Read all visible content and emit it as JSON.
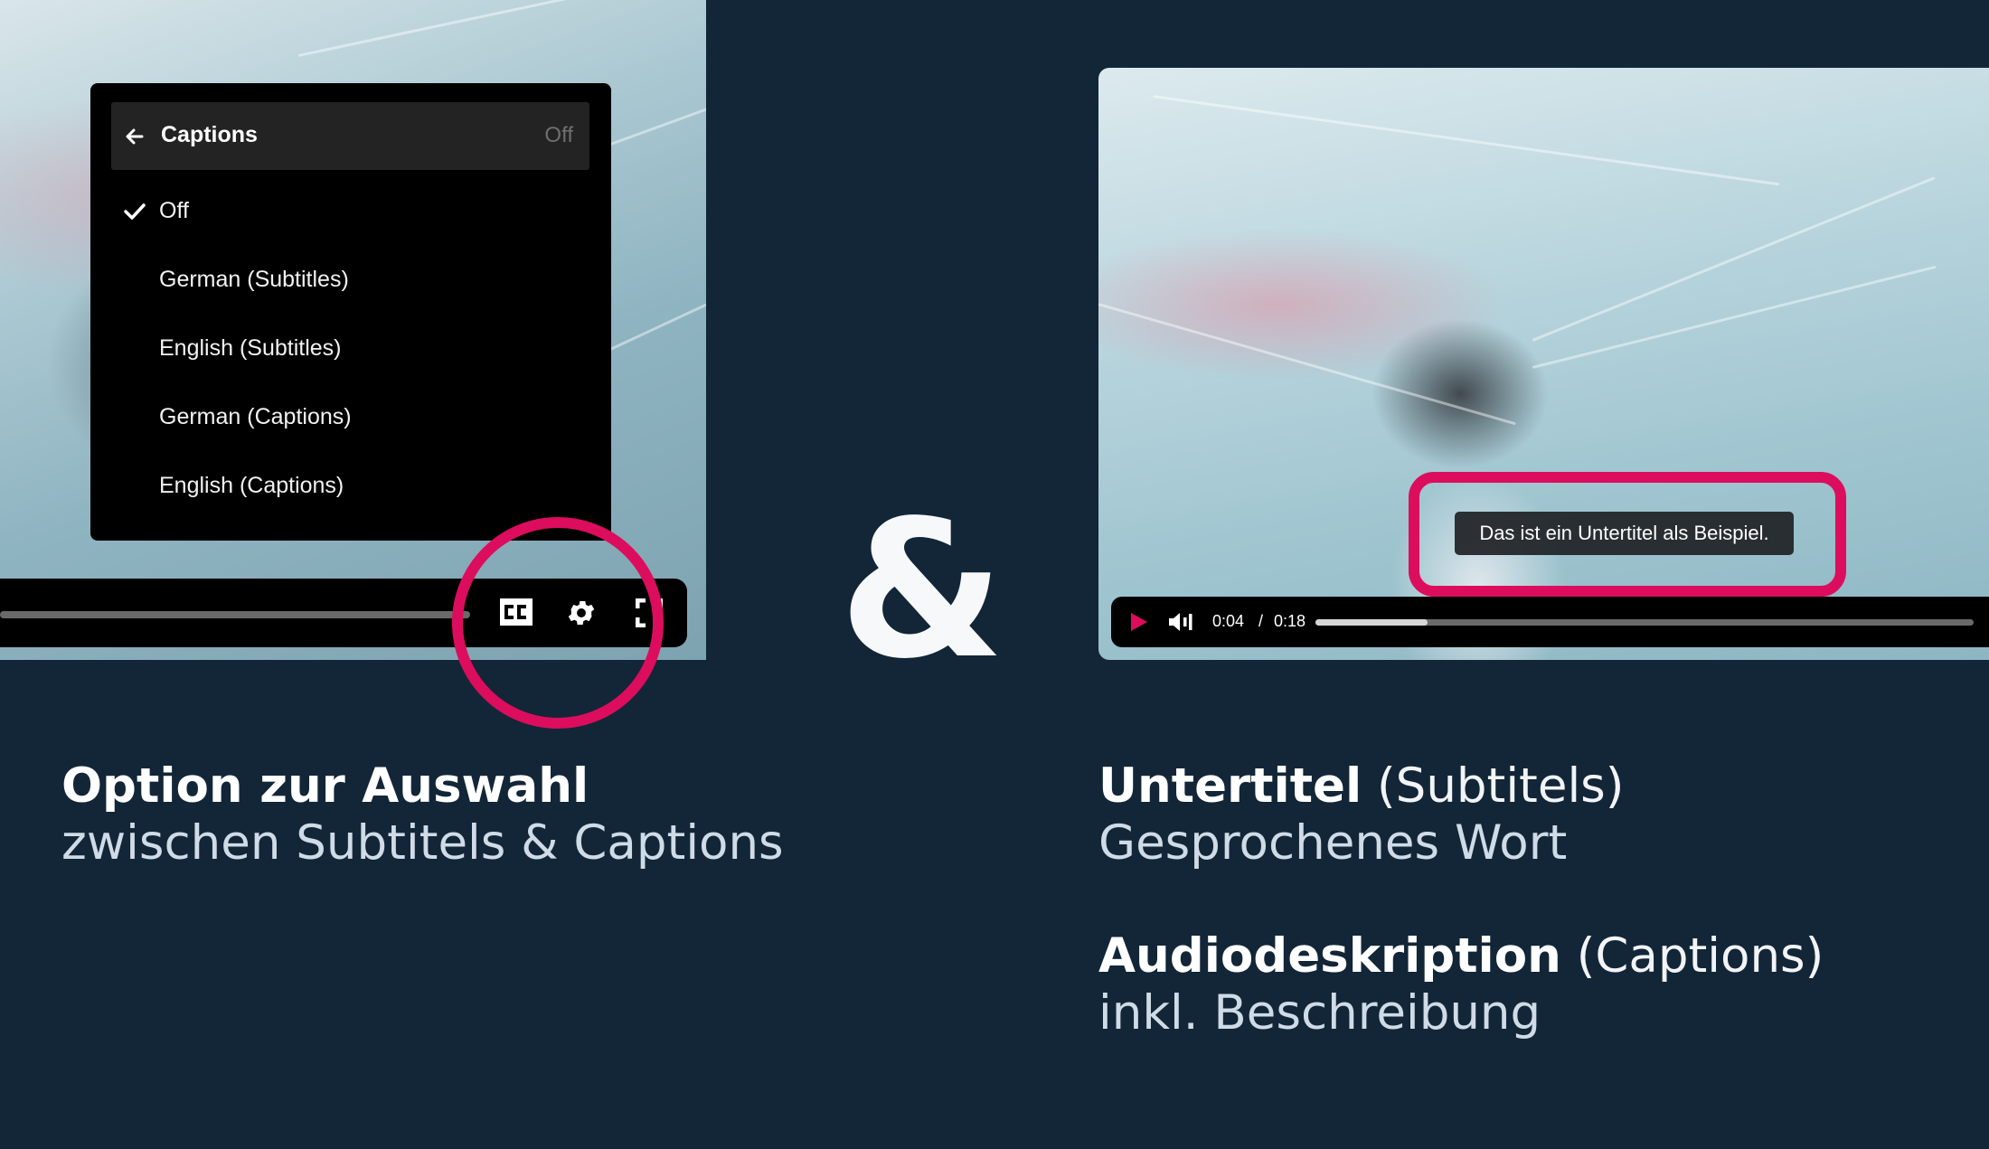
{
  "left_player": {
    "caption_menu": {
      "title": "Captions",
      "current_value": "Off",
      "items": [
        {
          "label": "Off",
          "selected": true
        },
        {
          "label": "German (Subtitles)",
          "selected": false
        },
        {
          "label": "English (Subtitles)",
          "selected": false
        },
        {
          "label": "German (Captions)",
          "selected": false
        },
        {
          "label": "English (Captions)",
          "selected": false
        }
      ]
    },
    "controls": {
      "icons": [
        "closed-captions-icon",
        "settings-gear-icon",
        "fullscreen-icon"
      ]
    }
  },
  "separator": "&",
  "right_player": {
    "subtitle_text": "Das ist ein Untertitel als Beispiel.",
    "controls": {
      "time_current": "0:04",
      "time_separator": "/",
      "time_total": "0:18",
      "progress_fraction": 0.17
    }
  },
  "descriptions": {
    "left": {
      "heading": "Option zur Auswahl",
      "subheading": "zwischen Subtitels & Captions"
    },
    "subtitles": {
      "heading": "Untertitel",
      "heading_paren": "(Subtitels)",
      "subheading": "Gesprochenes Wort"
    },
    "captions": {
      "heading": "Audiodeskription",
      "heading_paren": "(Captions)",
      "subheading": "inkl. Beschreibung"
    }
  },
  "colors": {
    "background": "#122638",
    "accent_pink": "#dc0d5d",
    "text_white": "#ffffff",
    "text_light": "#cfdbe6"
  }
}
